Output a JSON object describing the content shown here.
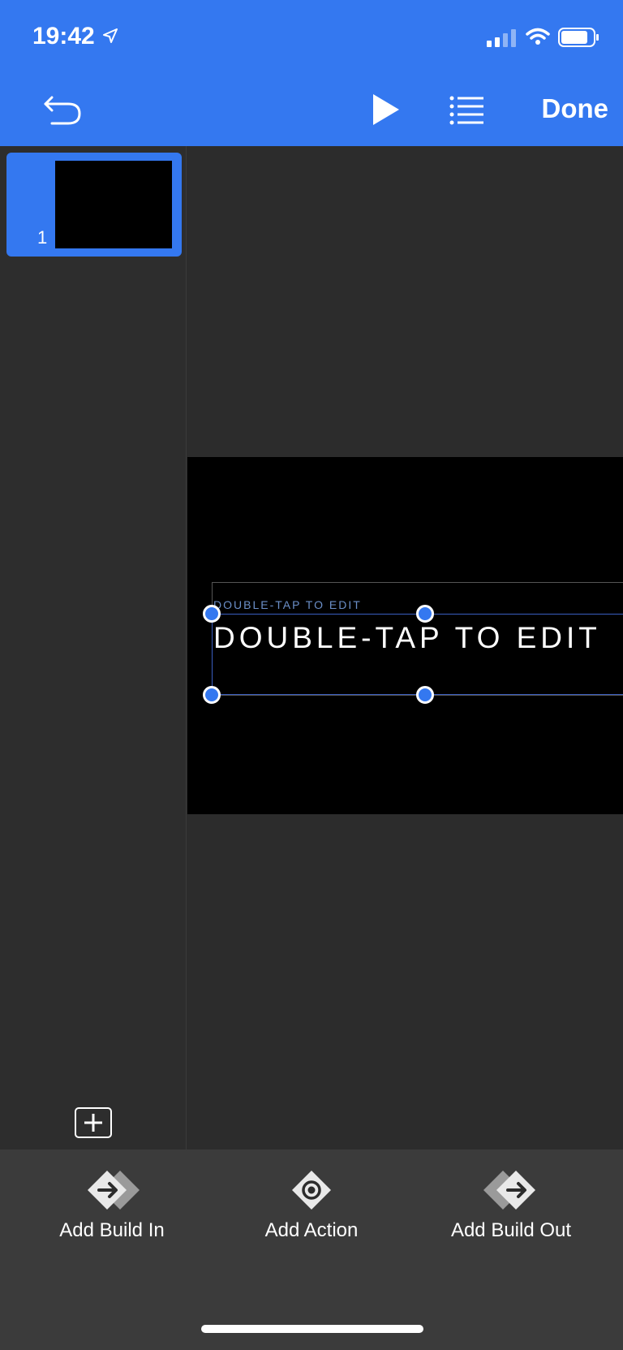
{
  "status": {
    "time": "19:42",
    "icons": [
      "location-arrow-icon",
      "signal-icon",
      "wifi-icon",
      "battery-icon"
    ]
  },
  "toolbar": {
    "undo_icon": "undo-icon",
    "play_icon": "play-icon",
    "list_icon": "list-icon",
    "done_label": "Done"
  },
  "sidebar": {
    "slides": [
      {
        "number": "1",
        "selected": true
      }
    ],
    "add_icon": "plus-icon"
  },
  "slide": {
    "subtitle_placeholder": "DOUBLE-TAP TO EDIT",
    "title_placeholder": "DOUBLE-TAP TO EDIT"
  },
  "bottom_actions": [
    {
      "label": "Add Build In",
      "icon": "build-in-icon"
    },
    {
      "label": "Add Action",
      "icon": "action-icon"
    },
    {
      "label": "Add Build Out",
      "icon": "build-out-icon"
    }
  ],
  "colors": {
    "accent": "#3478f0",
    "canvas_bg": "#2c2c2c",
    "bottom_bar_bg": "#3b3b3b",
    "slide_bg": "#000000"
  }
}
